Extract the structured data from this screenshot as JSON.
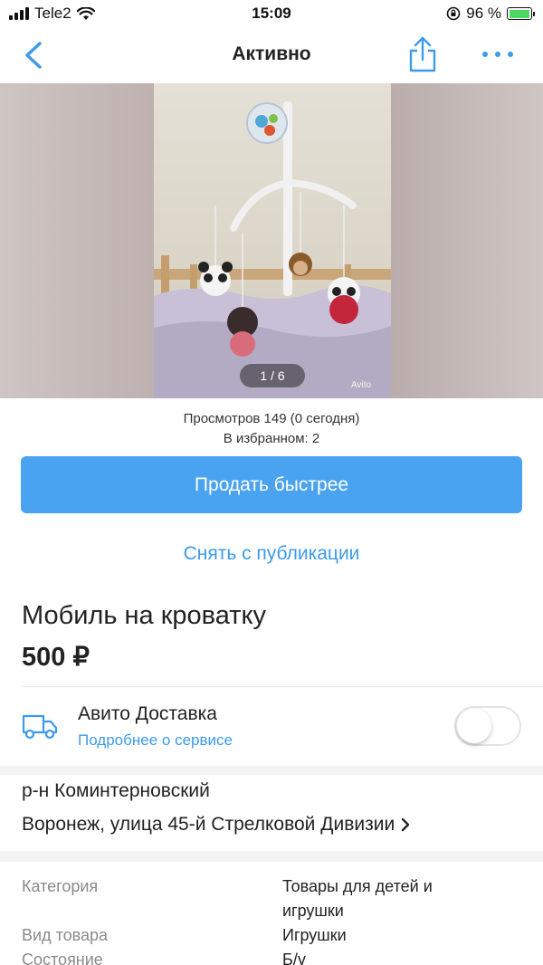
{
  "status_bar": {
    "carrier": "Tele2",
    "time": "15:09",
    "battery_percent": "96 %",
    "battery_level": 0.96
  },
  "nav": {
    "title": "Активно",
    "icons": {
      "back": "chevron-left-icon",
      "share": "share-icon",
      "more": "more-icon"
    }
  },
  "gallery": {
    "counter": "1 / 6",
    "watermark": "Avito"
  },
  "stats": {
    "views": "Просмотров 149 (0 сегодня)",
    "favorites": "В избранном: 2"
  },
  "actions": {
    "sell_faster": "Продать быстрее",
    "unpublish": "Снять с публикации"
  },
  "listing": {
    "title": "Мобиль на кроватку",
    "price": "500 ₽"
  },
  "delivery": {
    "title": "Авито Доставка",
    "link": "Подробнее о сервисе",
    "enabled": false
  },
  "location": {
    "district": "р-н Коминтерновский",
    "address": "Воронеж, улица 45-й Стрелковой Дивизии"
  },
  "params": [
    {
      "label": "Категория",
      "value": "Товары для детей и игрушки"
    },
    {
      "label": "Вид товара",
      "value": "Игрушки"
    },
    {
      "label": "Состояние",
      "value": "Б/у"
    }
  ],
  "colors": {
    "accent": "#4aa3f0",
    "link": "#3d9be9",
    "battery": "#4cd964"
  }
}
